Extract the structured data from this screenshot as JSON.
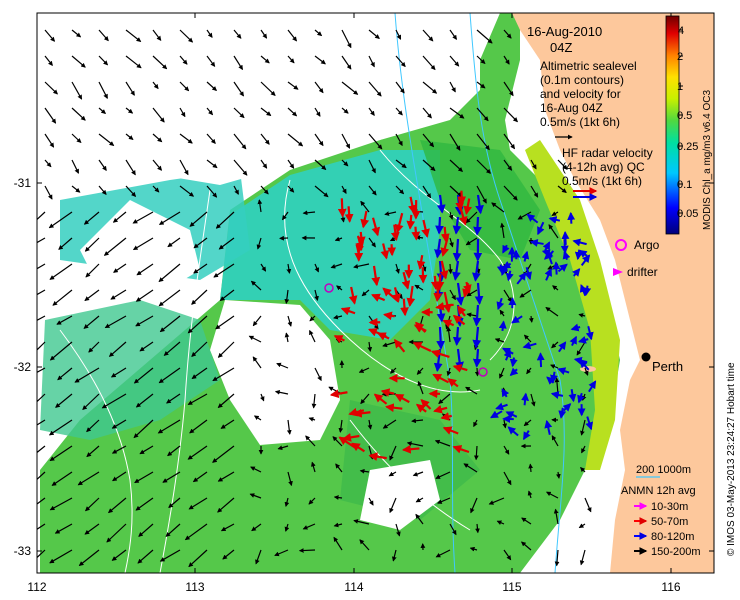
{
  "title_block": {
    "date": "16-Aug-2010",
    "time": "04Z",
    "altimetry_lines": [
      "Altimetric sealevel",
      "(0.1m contours)",
      "and velocity for",
      "16-Aug 04Z",
      "0.5m/s (1kt 6h)"
    ],
    "hf_lines": [
      "HF radar velocity",
      "(4-12h avg) QC",
      "0.5m/s (1kt 6h)"
    ]
  },
  "colorbar": {
    "title": "MODIS Chl_a mg/m3 v6.4 OC3",
    "tick_labels": [
      "4",
      "2",
      "1",
      "0.5",
      "0.25",
      "0.1",
      "0.05"
    ]
  },
  "axes": {
    "x_ticks": [
      "112",
      "113",
      "114",
      "115",
      "116"
    ],
    "y_ticks": [
      "-31",
      "-32",
      "-33"
    ]
  },
  "markers": {
    "argo_label": "Argo",
    "drifter_label": "drifter",
    "city_label": "Perth"
  },
  "depth_legend": {
    "contours_label": "200  1000m",
    "anmn_title": "ANMN 12h avg",
    "items": [
      {
        "label": "10-30m",
        "color": "#ff00ff"
      },
      {
        "label": "50-70m",
        "color": "#ff0000"
      },
      {
        "label": "80-120m",
        "color": "#0000ff"
      },
      {
        "label": "150-200m",
        "color": "#000000"
      }
    ]
  },
  "footer_credit": "© IMOS 03-May-2013 23:24:27 Hobart time",
  "colors": {
    "land": "#fdc89c",
    "ocean_green": "#55c84a",
    "ocean_cyan": "#30d0c0",
    "hf_red": "#e00000",
    "hf_blue": "#0000e0"
  }
}
